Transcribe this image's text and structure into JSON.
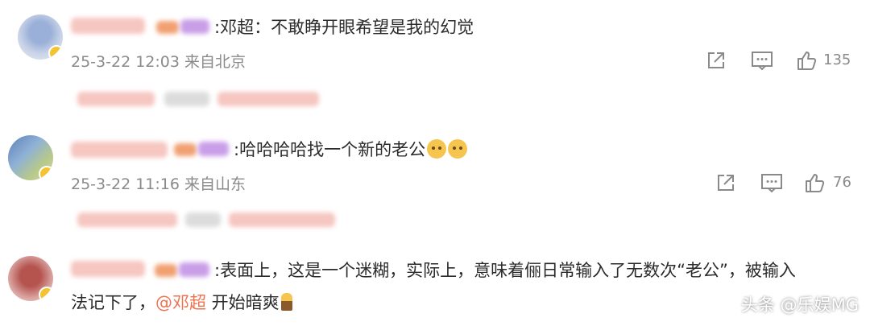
{
  "comments": [
    {
      "text": ":邓超：不敢睁开眼希望是我的幻觉",
      "time": "25-3-22 12:03",
      "location": "来自北京",
      "likes": "135"
    },
    {
      "text": ":哈哈哈哈找一个新的老公",
      "time": "25-3-22 11:16",
      "location": "来自山东",
      "likes": "76"
    },
    {
      "text_line1": ":表面上，这是一个迷糊，实际上，意味着俪日常输入了无数次“老公”，被输入",
      "text_line2_a": "法记下了，",
      "mention": "@邓超",
      "text_line2_b": " 开始暗爽"
    }
  ],
  "icons": [
    "share-icon",
    "comment-icon",
    "like-icon",
    "emoji-icon",
    "torch-emoji-icon"
  ],
  "colors": {
    "mention": "#eb7350",
    "meta": "#8a8a8a",
    "badge": "#f4c430"
  },
  "watermark": "头条 @乐娱MG"
}
